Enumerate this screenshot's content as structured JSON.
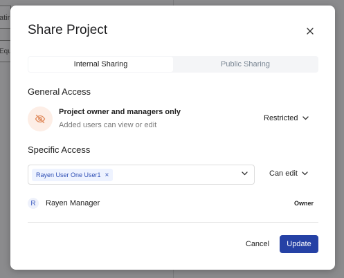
{
  "background": {
    "cell_top": "atir",
    "cell_bottom": "Equ"
  },
  "modal": {
    "title": "Share Project",
    "tabs": [
      {
        "label": "Internal Sharing",
        "active": true
      },
      {
        "label": "Public Sharing",
        "active": false
      }
    ],
    "general_access": {
      "heading": "General Access",
      "icon": "eye-off-icon",
      "main_text": "Project owner and managers only",
      "sub_text": "Added users can view or edit",
      "permission": "Restricted"
    },
    "specific_access": {
      "heading": "Specific Access",
      "selected_users": [
        "Rayen User One User1"
      ],
      "permission": "Can edit",
      "members": [
        {
          "initial": "R",
          "name": "Rayen Manager",
          "role": "Owner"
        }
      ]
    },
    "actions": {
      "cancel_label": "Cancel",
      "update_label": "Update"
    }
  },
  "colors": {
    "primary": "#2541a5",
    "chip_bg": "#eef3ff",
    "icon_bg": "#fdeee6",
    "icon_fg": "#e08a5c"
  }
}
